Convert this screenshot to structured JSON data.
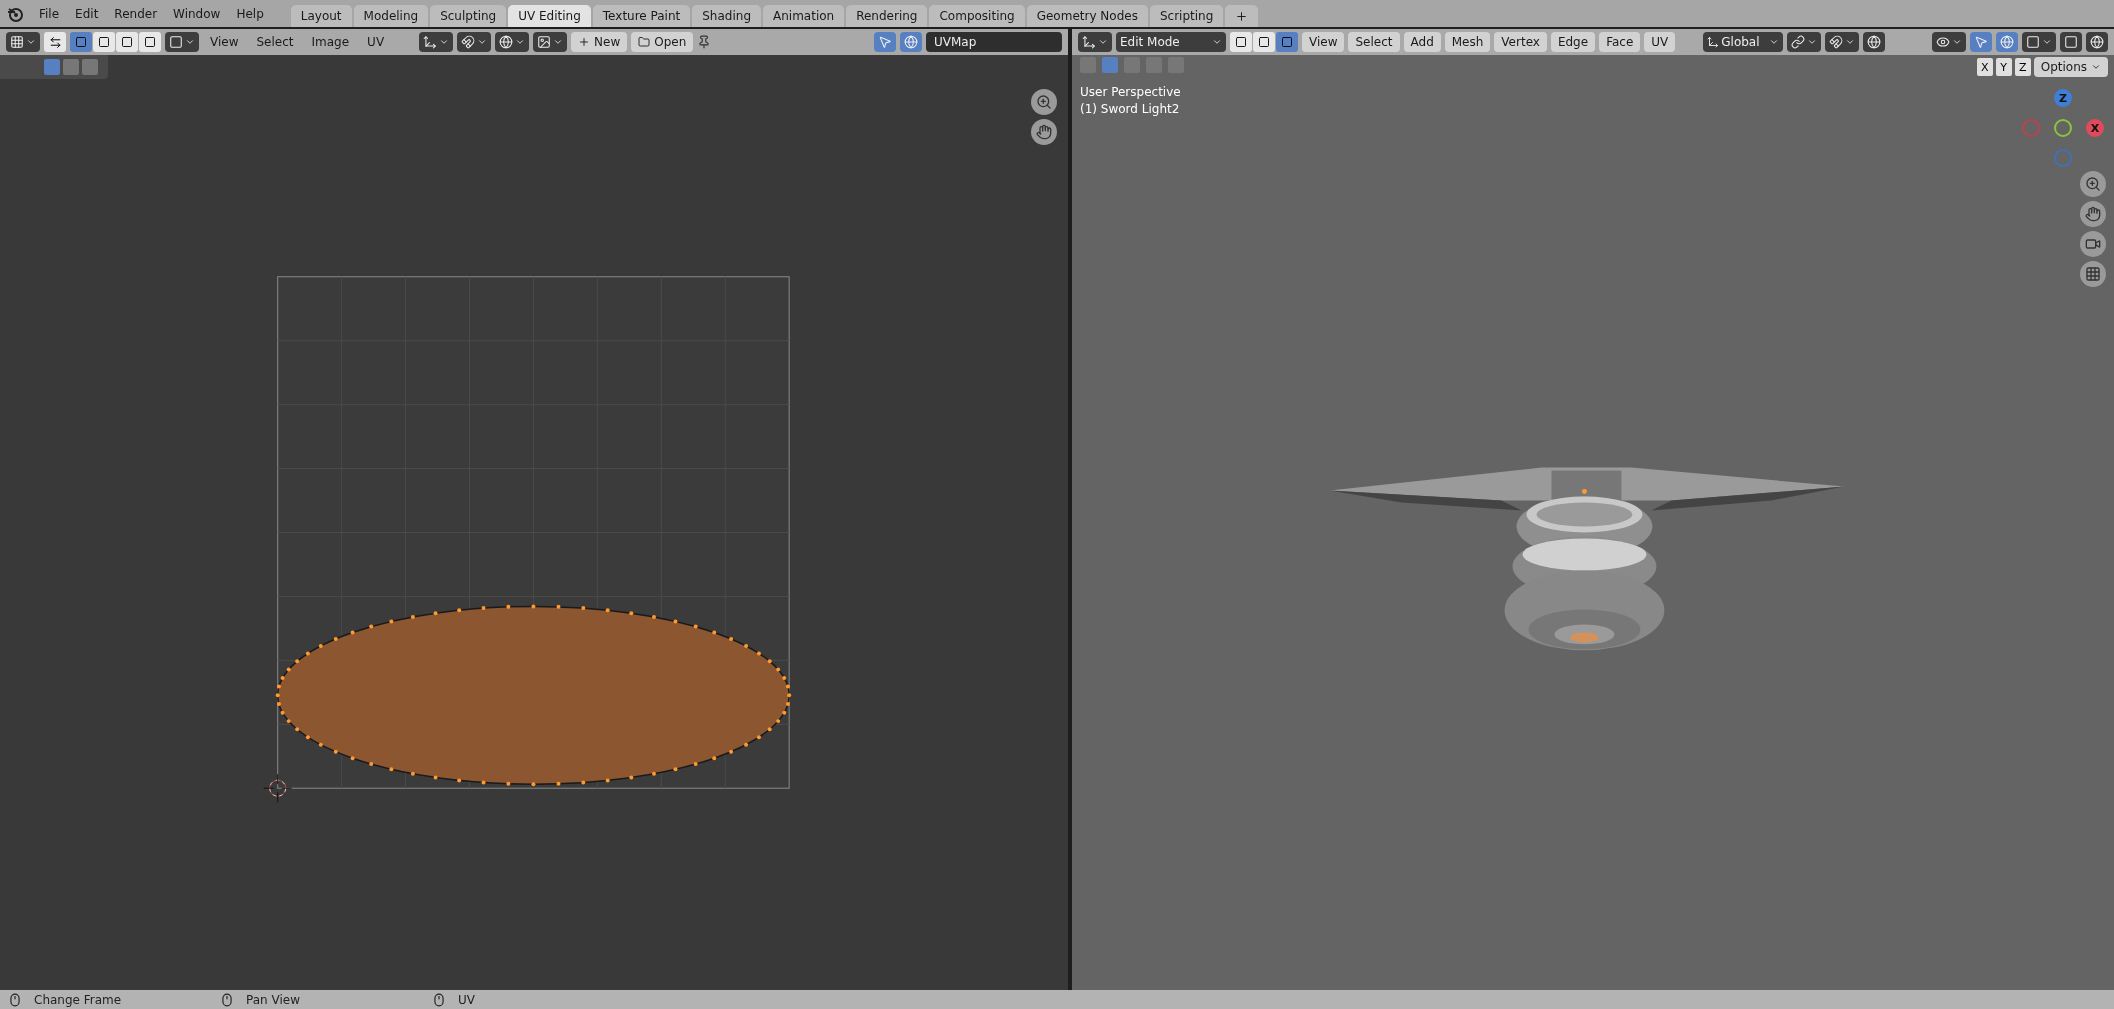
{
  "menu": [
    "File",
    "Edit",
    "Render",
    "Window",
    "Help"
  ],
  "workspace_tabs": [
    {
      "label": "Layout",
      "selected": false
    },
    {
      "label": "Modeling",
      "selected": false
    },
    {
      "label": "Sculpting",
      "selected": false
    },
    {
      "label": "UV Editing",
      "selected": true
    },
    {
      "label": "Texture Paint",
      "selected": false
    },
    {
      "label": "Shading",
      "selected": false
    },
    {
      "label": "Animation",
      "selected": false
    },
    {
      "label": "Rendering",
      "selected": false
    },
    {
      "label": "Compositing",
      "selected": false
    },
    {
      "label": "Geometry Nodes",
      "selected": false
    },
    {
      "label": "Scripting",
      "selected": false
    }
  ],
  "uv_editor": {
    "select_modes": [
      {
        "selected": true
      },
      {
        "selected": false
      },
      {
        "selected": false
      },
      {
        "selected": false
      }
    ],
    "header_menus": [
      "View",
      "Select",
      "Image",
      "UV"
    ],
    "new_button": "New",
    "open_button": "Open",
    "uv_map_field": "UVMap"
  },
  "viewport": {
    "mode": "Edit Mode",
    "select_modes": [
      {
        "selected": false
      },
      {
        "selected": false
      },
      {
        "selected": true
      }
    ],
    "header_menus": [
      "View",
      "Select",
      "Add",
      "Mesh",
      "Vertex",
      "Edge",
      "Face",
      "UV"
    ],
    "orientation": "Global",
    "axis_toggles": [
      "X",
      "Y",
      "Z"
    ],
    "options": "Options",
    "view_name": "User Perspective",
    "object_name": "(1) Sword Light2",
    "gizmo_z": "Z",
    "gizmo_x": "X"
  },
  "status_bar": [
    "Change Frame",
    "Pan View",
    "UV"
  ]
}
